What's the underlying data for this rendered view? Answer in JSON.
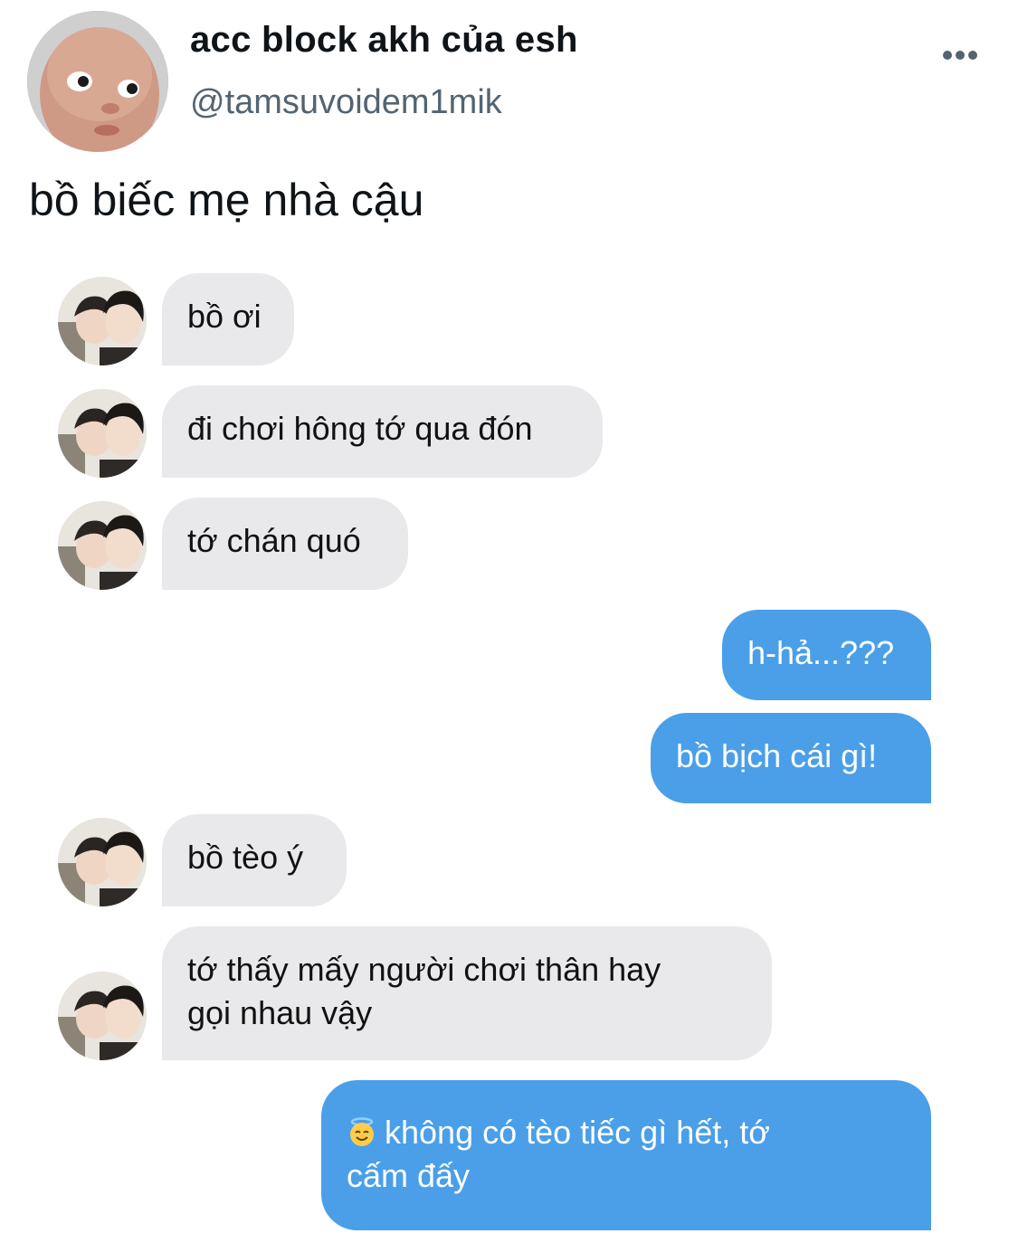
{
  "tweet": {
    "display_name": "acc block akh của esh",
    "handle": "@tamsuvoidem1mik",
    "more_icon": "more-horizontal-icon",
    "text": "bồ biếc mẹ nhà cậu"
  },
  "chat": {
    "colors": {
      "incoming_bubble": "#e9e9eb",
      "outgoing_bubble": "#4a9fe8"
    },
    "messages": [
      {
        "direction": "incoming",
        "text": "bồ ơi"
      },
      {
        "direction": "incoming",
        "text": "đi chơi hông tớ qua đón"
      },
      {
        "direction": "incoming",
        "text": "tớ chán quó"
      },
      {
        "direction": "outgoing",
        "text": "h-hả...???"
      },
      {
        "direction": "outgoing",
        "text": "bồ bịch cái gì!"
      },
      {
        "direction": "incoming",
        "text": "bồ tèo ý"
      },
      {
        "direction": "incoming",
        "line1": "tớ thấy mấy người chơi thân hay",
        "line2": "gọi nhau vậy"
      },
      {
        "direction": "outgoing",
        "emoji": "halo-smile-emoji",
        "line1": "không có tèo tiếc gì hết, tớ",
        "line2": "cấm đấy"
      }
    ]
  }
}
